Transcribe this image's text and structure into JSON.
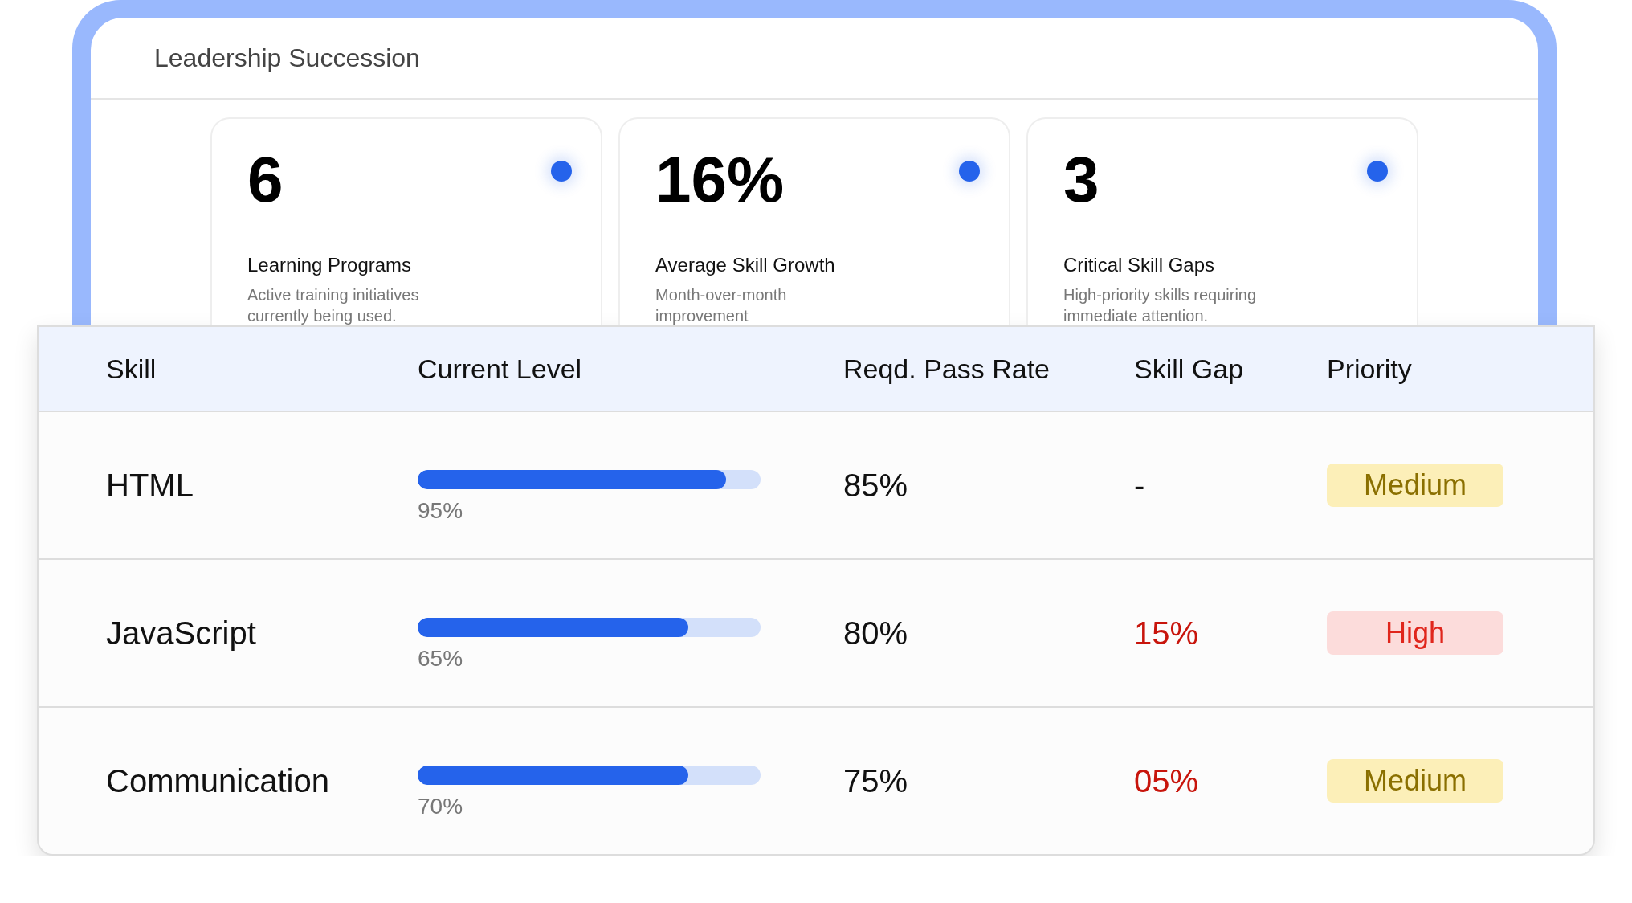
{
  "header": {
    "title": "Leadership Succession"
  },
  "stats": [
    {
      "value": "6",
      "label": "Learning Programs",
      "description": "Active training initiatives currently being used."
    },
    {
      "value": "16%",
      "label": "Average Skill Growth",
      "description": "Month-over-month improvement"
    },
    {
      "value": "3",
      "label": "Critical Skill Gaps",
      "description": "High-priority skills requiring immediate attention."
    }
  ],
  "table": {
    "columns": [
      "Skill",
      "Current Level",
      "Reqd. Pass Rate",
      "Skill Gap",
      "Priority"
    ],
    "rows": [
      {
        "skill": "HTML",
        "level": 0.9,
        "level_text": "95%",
        "pass_rate": "85%",
        "gap": {
          "text": "-",
          "alert": false
        },
        "priority": {
          "label": "Medium",
          "kind": "medium"
        }
      },
      {
        "skill": "JavaScript",
        "level": 0.79,
        "level_text": "65%",
        "pass_rate": "80%",
        "gap": {
          "text": "15%",
          "alert": true
        },
        "priority": {
          "label": "High",
          "kind": "high"
        }
      },
      {
        "skill": "Communication",
        "level": 0.79,
        "level_text": "70%",
        "pass_rate": "75%",
        "gap": {
          "text": "05%",
          "alert": true
        },
        "priority": {
          "label": "Medium",
          "kind": "medium"
        }
      }
    ]
  }
}
